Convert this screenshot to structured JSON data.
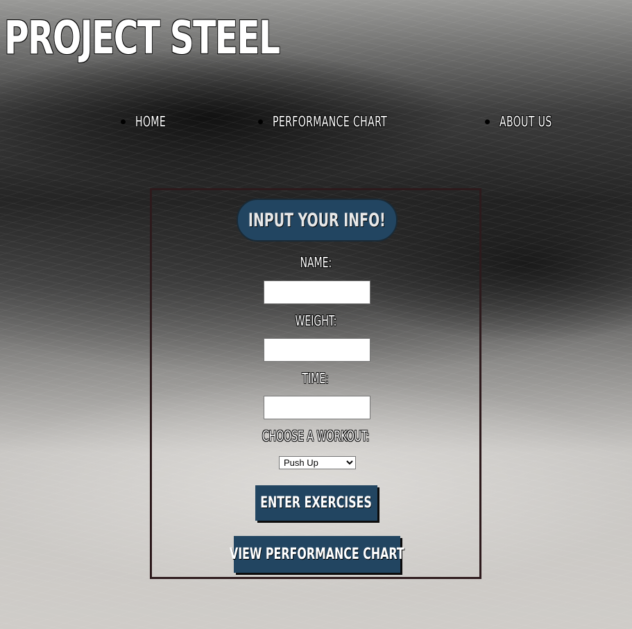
{
  "site": {
    "title": "PROJECT STEEL"
  },
  "nav": {
    "items": [
      {
        "label": "HOME"
      },
      {
        "label": "PERFORMANCE CHART"
      },
      {
        "label": "ABOUT US"
      }
    ]
  },
  "form": {
    "heading": "INPUT YOUR INFO!",
    "name_label": "NAME:",
    "name_value": "",
    "weight_label": "WEIGHT:",
    "weight_value": "",
    "time_label": "TIME:",
    "time_value": "",
    "workout_label": "CHOOSE A WORKOUT:",
    "workout_selected": "Push Up",
    "enter_button": "ENTER EXERCISES",
    "view_chart_button": "VIEW PERFORMANCE CHART"
  },
  "colors": {
    "accent": "#224561",
    "box_border": "#2d1a1c",
    "text": "#ffffff"
  }
}
